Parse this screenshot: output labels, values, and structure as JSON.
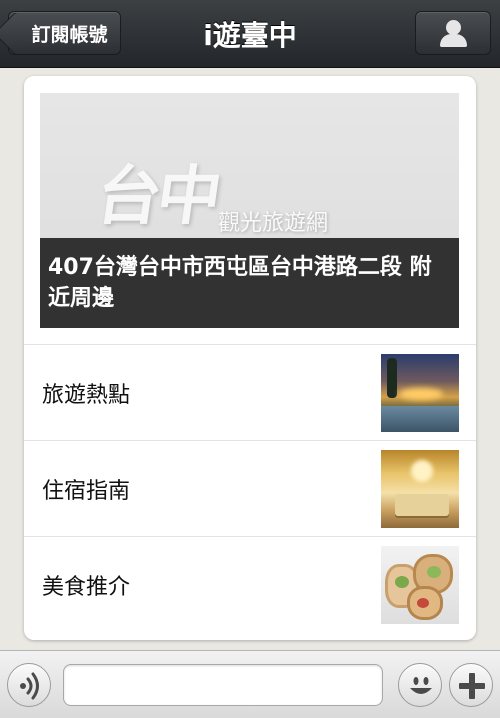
{
  "header": {
    "back_label": "訂閱帳號",
    "title": "i遊臺中",
    "profile_icon": "person-icon"
  },
  "article": {
    "cover_logo_main": "台中",
    "cover_logo_sub": "觀光旅遊網",
    "cover_caption": "407台灣台中市西屯區台中港路二段 附近周邊"
  },
  "menu": {
    "items": [
      {
        "label": "旅遊熱點",
        "thumb": "resort-pool-night-image"
      },
      {
        "label": "住宿指南",
        "thumb": "hotel-room-image"
      },
      {
        "label": "美食推介",
        "thumb": "food-wraps-image"
      }
    ]
  },
  "composer": {
    "voice_icon": "voice-wave-icon",
    "input_value": "",
    "emoji_icon": "smiley-icon",
    "plus_icon": "plus-icon"
  }
}
